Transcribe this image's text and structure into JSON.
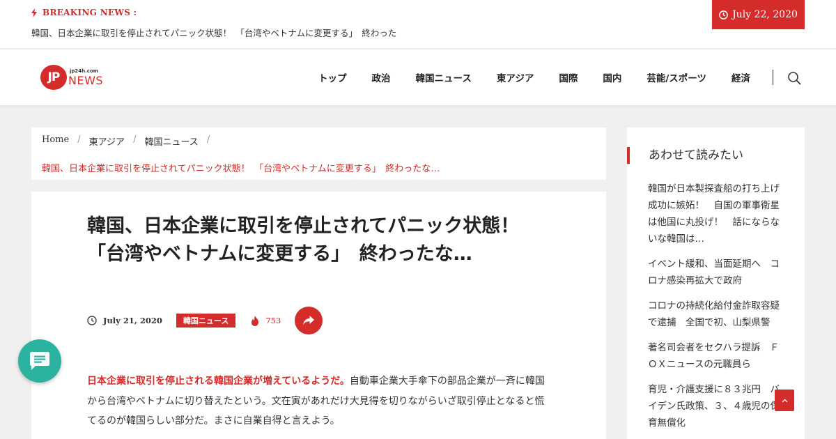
{
  "topbar": {
    "breaking_label": "BREAKING NEWS :",
    "breaking_text": "韓国、日本企業に取引を停止されてパニック状態！　「台湾やベトナムに変更する」　終わった",
    "date": "July 22, 2020"
  },
  "logo": {
    "small": "jp24h.com",
    "mark": "JP",
    "news": "NEWS"
  },
  "nav": {
    "items": [
      "トップ",
      "政治",
      "韓国ニュース",
      "東アジア",
      "国際",
      "国内",
      "芸能/スポーツ",
      "経済"
    ]
  },
  "breadcrumb": {
    "items": [
      "Home",
      "東アジア",
      "韓国ニュース"
    ],
    "current": "韓国、日本企業に取引を停止されてパニック状態！　「台湾やベトナムに変更する」　終わったな…"
  },
  "article": {
    "title": "韓国、日本企業に取引を停止されてパニック状態！　「台湾やベトナムに変更する」　終わったな…",
    "date": "July 21, 2020",
    "category": "韓国ニュース",
    "views": "753",
    "lead_highlight": "日本企業に取引を停止される韓国企業が増えているようだ。",
    "lead_text": "自動車企業大手傘下の部品企業が一斉に韓国から台湾やベトナムに切り替えたという。文在寅があれだけ大見得を切りながらいざ取引停止となると慌てるのが韓国らしい部分だ。まさに自業自得と言えよう。"
  },
  "sidebar": {
    "title": "あわせて読みたい",
    "items": [
      "韓国が日本製探査船の打ち上げ成功に嫉妬！　自国の軍事衛星は他国に丸投げ！　話にならないな韓国は…",
      "イベント緩和、当面延期へ　コロナ感染再拡大で政府",
      "コロナの持続化給付金詐取容疑で逮捕　全国で初、山梨県警",
      "著名司会者をセクハラ提訴　ＦＯＸニュースの元職員ら",
      "育児・介護支援に８３兆円　バイデン氏政策、３、４歳児の保育無償化"
    ]
  },
  "colors": {
    "accent": "#d42b2b",
    "chat": "#2bb3a0"
  }
}
